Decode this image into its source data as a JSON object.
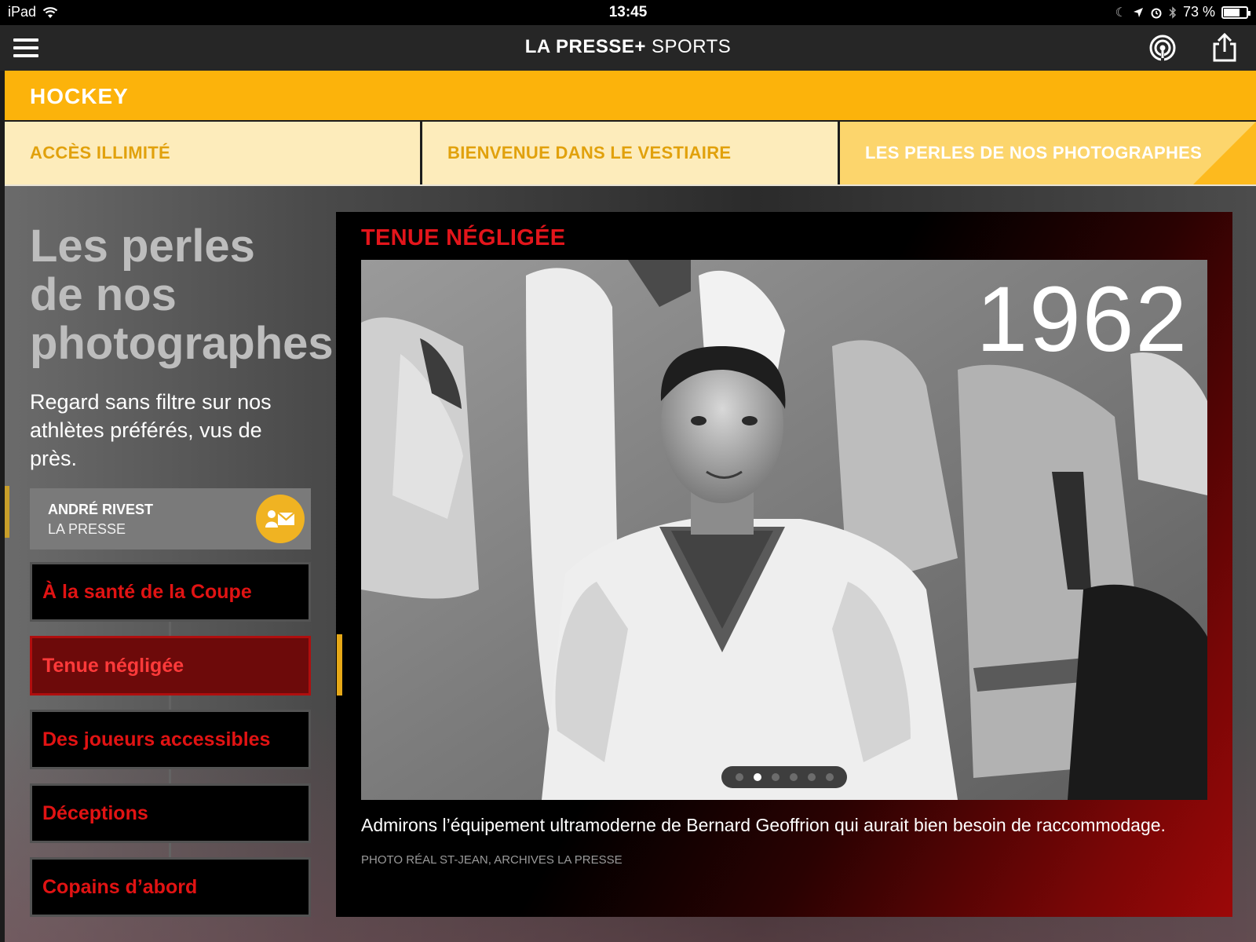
{
  "status_bar": {
    "device": "iPad",
    "time": "13:45",
    "battery": "73 %",
    "battery_level": 0.73
  },
  "nav": {
    "brand_main": "LA PRESSE+",
    "brand_sub": "SPORTS",
    "icons": [
      "menu-icon",
      "podcast-icon",
      "share-icon"
    ]
  },
  "section": {
    "title": "HOCKEY",
    "color": "#fcb30b"
  },
  "tabs": [
    {
      "label": "ACCÈS ILLIMITÉ",
      "active": false
    },
    {
      "label": "BIENVENUE DANS LE VESTIAIRE",
      "active": false
    },
    {
      "label": "LES PERLES DE NOS PHOTOGRAPHES",
      "active": true
    }
  ],
  "page": {
    "heading": "Les perles de nos photographes",
    "subheading": "Regard sans filtre sur nos athlètes préférés, vus de près."
  },
  "author": {
    "name": "ANDRÉ RIVEST",
    "organization": "LA PRESSE"
  },
  "stories": [
    {
      "label": "À la santé de la Coupe",
      "active": false
    },
    {
      "label": "Tenue négligée",
      "active": true
    },
    {
      "label": "Des joueurs accessibles",
      "active": false
    },
    {
      "label": "Déceptions",
      "active": false
    },
    {
      "label": "Copains d’abord",
      "active": false
    }
  ],
  "article": {
    "title": "TENUE NÉGLIGÉE",
    "year": "1962",
    "caption": "Admirons l’équipement ultramoderne de Bernard Geoffrion qui aurait bien besoin de raccommodage.",
    "credit": "PHOTO RÉAL ST-JEAN, ARCHIVES LA PRESSE",
    "slide_count": 6,
    "current_slide": 2
  },
  "colors": {
    "accent_red": "#e3151b",
    "accent_yellow": "#fcb30b",
    "tab_bg": "#fdecbb"
  }
}
